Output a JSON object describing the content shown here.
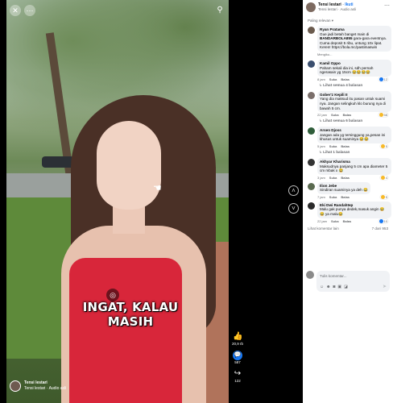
{
  "video": {
    "caption": "INGAT, KALAU MASIH",
    "footer_name": "Tensi lestari",
    "footer_sub": "Tensi lestari · Audio asli",
    "search_icon": "search-icon",
    "top_left_icons": [
      "back-icon",
      "more-icon"
    ]
  },
  "side_actions": [
    {
      "icon": "like-icon",
      "count": "20,9 rb"
    },
    {
      "icon": "comment-icon",
      "count": "587"
    },
    {
      "icon": "share-icon",
      "count": "122"
    }
  ],
  "post": {
    "author": "Tensi lestari",
    "follow": "Ikuti",
    "sub": "Tensi lestari · Audio asli",
    "sort_label": "Paling relevan"
  },
  "comments": [
    {
      "author": "Ryan Pratama",
      "text_before": "Gue jadi betah banget main di ",
      "highlight": "BANDARBOLA855",
      "text_after": " gara-gara eventnya. Cuma deposit 5 ribu, untung 10x lipat. Keren! https://bola.mc/pastimaswin",
      "time": "Mengiku...",
      "actions": [],
      "replies": "",
      "avatar_color": "#6b5b4e",
      "react_count": ""
    },
    {
      "author": "Kamil Oppo",
      "text_before": "Paham sekali dia ini, sdh pernah ngerasain yg 15cm 😂😂😂😂",
      "highlight": "",
      "text_after": "",
      "time": "8 jam",
      "actions": [
        "Suka",
        "Balas"
      ],
      "replies": "Lihat semua 4 balasan",
      "avatar_color": "#3a4e6e",
      "react_count": "12"
    },
    {
      "author": "Gober'z Kepili II",
      "text_before": "Yang dia maksud itu pasan untuk suami nya. Jangan selingkuh klo burung nya di bawah 5 cm.",
      "highlight": "",
      "text_after": "",
      "time": "22 jam",
      "actions": [
        "Suka",
        "Balas"
      ],
      "replies": "Lihat semua 6 balasan",
      "avatar_color": "#7a6e6a",
      "react_count": "58"
    },
    {
      "author": "Arsen Djoss",
      "text_before": "Jangan ada yg tersinggung ya,pesan ini khusus untuk suaminya 😂😂",
      "highlight": "",
      "text_after": "",
      "time": "5 jam",
      "actions": [
        "Suka",
        "Balas"
      ],
      "replies": "Lihat 1 balasan",
      "avatar_color": "#2f5d3a",
      "react_count": "5"
    },
    {
      "author": "Akhyar Kharisma",
      "text_before": "Maksudnya panjang 5 cm apa diameter 5 cm mbak x 😂",
      "highlight": "",
      "text_after": "",
      "time": "3 jam",
      "actions": [
        "Suka",
        "Balas"
      ],
      "replies": "",
      "avatar_color": "#333333",
      "react_count": "4"
    },
    {
      "author": "Ilion Jebe",
      "text_before": "Sindiran suaminya ya deh 😂",
      "highlight": "",
      "text_after": "",
      "time": "7 jam",
      "actions": [
        "Suka",
        "Balas"
      ],
      "replies": "",
      "avatar_color": "#5a6a50",
      "react_count": "5"
    },
    {
      "author": "Eki Dwi Randahtep",
      "text_before": "Malu gak punya dedek,masuk angin 😂😂 ya malu😂",
      "highlight": "",
      "text_after": "",
      "time": "22 jam",
      "actions": [
        "Suka",
        "Balas"
      ],
      "replies": "",
      "avatar_color": "#2a2a2a",
      "react_count": "10"
    }
  ],
  "more_comments": {
    "label": "Lihat komentar lain",
    "count": "7 dari 953"
  },
  "composer": {
    "placeholder": "Tulis komentar..."
  },
  "nav": {
    "up": "chevron-up-icon",
    "down": "chevron-down-icon"
  }
}
